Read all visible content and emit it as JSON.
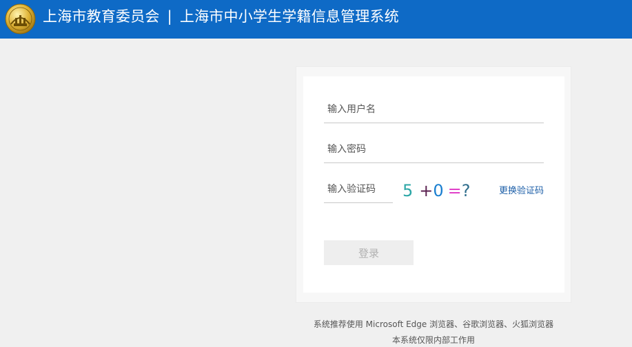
{
  "header": {
    "org_name": "上海市教育委员会",
    "separator": "|",
    "system_name": "上海市中小学生学籍信息管理系统",
    "background_color": "#0e6ac6",
    "logo_icon": "education-commission-emblem-icon"
  },
  "login": {
    "username_placeholder": "输入用户名",
    "password_placeholder": "输入密码",
    "captcha_placeholder": "输入验证码",
    "captcha": {
      "chars": [
        "5",
        "+",
        "0",
        "=",
        "?"
      ],
      "colors": [
        "#2ba6a6",
        "#5a1f4f",
        "#1a7fd0",
        "#e040c8",
        "#2e6d8c"
      ]
    },
    "refresh_captcha_label": "更换验证码",
    "login_button_label": "登录"
  },
  "footer": {
    "browser_note": "系统推荐使用 Microsoft Edge 浏览器、谷歌浏览器、火狐浏览器",
    "internal_note": "本系统仅限内部工作用"
  }
}
